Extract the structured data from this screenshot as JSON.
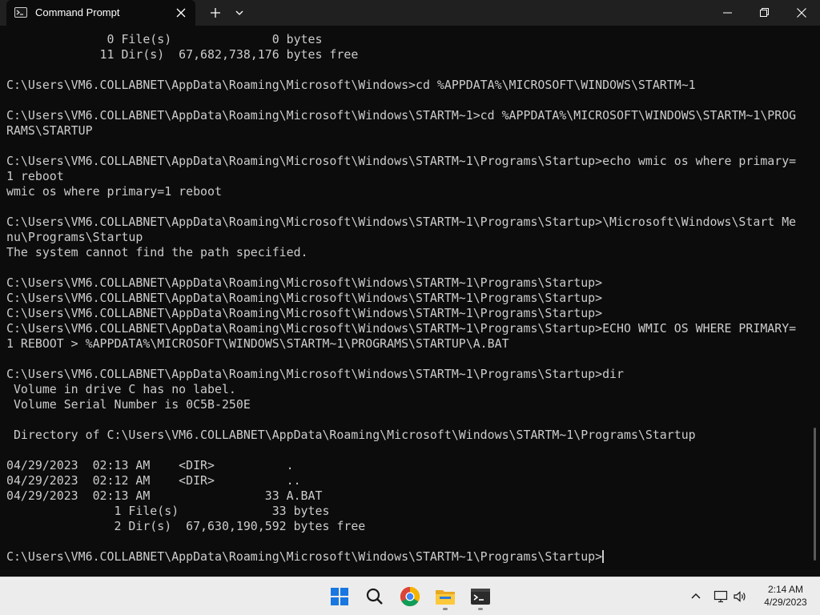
{
  "window": {
    "tab_title": "Command Prompt",
    "tab_icon": "cmd-icon",
    "controls": [
      "minimize-icon",
      "maximize-icon",
      "close-icon"
    ]
  },
  "terminal": {
    "lines": [
      "              0 File(s)              0 bytes",
      "             11 Dir(s)  67,682,738,176 bytes free",
      "",
      "C:\\Users\\VM6.COLLABNET\\AppData\\Roaming\\Microsoft\\Windows>cd %APPDATA%\\MICROSOFT\\WINDOWS\\STARTM~1",
      "",
      "C:\\Users\\VM6.COLLABNET\\AppData\\Roaming\\Microsoft\\Windows\\STARTM~1>cd %APPDATA%\\MICROSOFT\\WINDOWS\\STARTM~1\\PROG",
      "RAMS\\STARTUP",
      "",
      "C:\\Users\\VM6.COLLABNET\\AppData\\Roaming\\Microsoft\\Windows\\STARTM~1\\Programs\\Startup>echo wmic os where primary=",
      "1 reboot",
      "wmic os where primary=1 reboot",
      "",
      "C:\\Users\\VM6.COLLABNET\\AppData\\Roaming\\Microsoft\\Windows\\STARTM~1\\Programs\\Startup>\\Microsoft\\Windows\\Start Me",
      "nu\\Programs\\Startup",
      "The system cannot find the path specified.",
      "",
      "C:\\Users\\VM6.COLLABNET\\AppData\\Roaming\\Microsoft\\Windows\\STARTM~1\\Programs\\Startup>",
      "C:\\Users\\VM6.COLLABNET\\AppData\\Roaming\\Microsoft\\Windows\\STARTM~1\\Programs\\Startup>",
      "C:\\Users\\VM6.COLLABNET\\AppData\\Roaming\\Microsoft\\Windows\\STARTM~1\\Programs\\Startup>",
      "C:\\Users\\VM6.COLLABNET\\AppData\\Roaming\\Microsoft\\Windows\\STARTM~1\\Programs\\Startup>ECHO WMIC OS WHERE PRIMARY=",
      "1 REBOOT > %APPDATA%\\MICROSOFT\\WINDOWS\\STARTM~1\\PROGRAMS\\STARTUP\\A.BAT",
      "",
      "C:\\Users\\VM6.COLLABNET\\AppData\\Roaming\\Microsoft\\Windows\\STARTM~1\\Programs\\Startup>dir",
      " Volume in drive C has no label.",
      " Volume Serial Number is 0C5B-250E",
      "",
      " Directory of C:\\Users\\VM6.COLLABNET\\AppData\\Roaming\\Microsoft\\Windows\\STARTM~1\\Programs\\Startup",
      "",
      "04/29/2023  02:13 AM    <DIR>          .",
      "04/29/2023  02:12 AM    <DIR>          ..",
      "04/29/2023  02:13 AM                33 A.BAT",
      "               1 File(s)             33 bytes",
      "               2 Dir(s)  67,630,190,592 bytes free",
      ""
    ],
    "prompt": "C:\\Users\\VM6.COLLABNET\\AppData\\Roaming\\Microsoft\\Windows\\STARTM~1\\Programs\\Startup>"
  },
  "taskbar": {
    "apps": [
      {
        "name": "start-icon"
      },
      {
        "name": "search-icon"
      },
      {
        "name": "chrome-icon"
      },
      {
        "name": "file-explorer-icon"
      },
      {
        "name": "terminal-icon"
      }
    ],
    "tray_icons": [
      "chevron-up-icon",
      "network-icon",
      "volume-icon"
    ],
    "time": "2:14 AM",
    "date": "4/29/2023"
  },
  "colors": {
    "terminal_bg": "#0c0c0c",
    "terminal_fg": "#cccccc",
    "titlebar_bg": "#202020",
    "taskbar_bg": "#ececec"
  }
}
